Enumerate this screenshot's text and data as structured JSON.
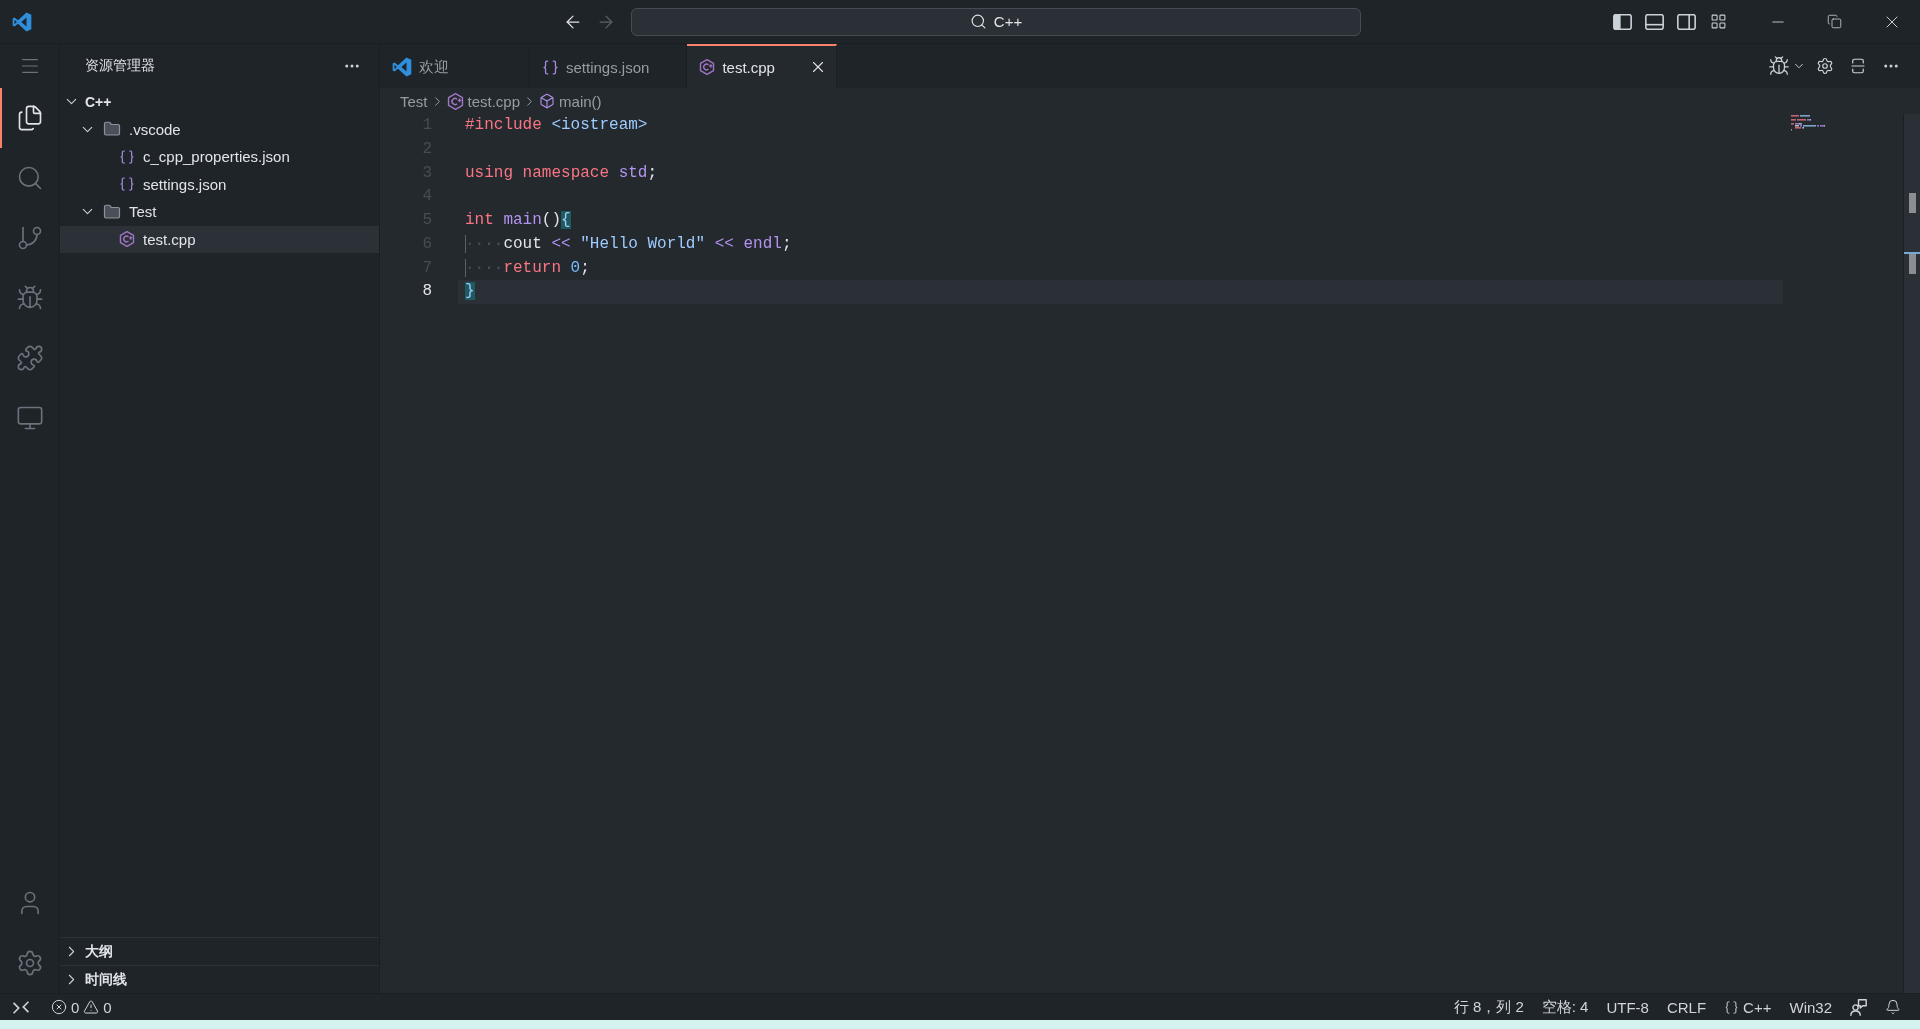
{
  "title_bar": {
    "navigation": {
      "back": {
        "disabled": false
      },
      "forward": {
        "disabled": true
      }
    },
    "command_center": {
      "label": "C++"
    },
    "layout_toggles": [
      {
        "kind": "primary_sidebar",
        "on": true
      },
      {
        "kind": "panel",
        "on": false
      },
      {
        "kind": "secondary_sidebar",
        "on": false
      }
    ]
  },
  "activity_bar": {
    "items": [
      {
        "kind": "explorer",
        "selected": true
      },
      {
        "kind": "search",
        "selected": false
      },
      {
        "kind": "source_control",
        "selected": false
      },
      {
        "kind": "run_debug",
        "selected": false
      },
      {
        "kind": "extensions",
        "selected": false
      },
      {
        "kind": "remote_explorer",
        "selected": false
      }
    ],
    "bottom": [
      {
        "kind": "accounts"
      },
      {
        "kind": "manage"
      }
    ]
  },
  "sidebar": {
    "title": "资源管理器",
    "tree": [
      {
        "label": "C++",
        "kind": "root",
        "expanded": true,
        "selected": false,
        "children": [
          {
            "label": ".vscode",
            "kind": "folder",
            "expanded": true,
            "selected": false,
            "children": [
              {
                "label": "c_cpp_properties.json",
                "kind": "json",
                "selected": false
              },
              {
                "label": "settings.json",
                "kind": "json",
                "selected": false
              }
            ]
          },
          {
            "label": "Test",
            "kind": "folder",
            "expanded": true,
            "selected": false,
            "children": [
              {
                "label": "test.cpp",
                "kind": "cpp",
                "selected": true
              }
            ]
          }
        ]
      }
    ],
    "sections": [
      {
        "label": "大纲",
        "expanded": false
      },
      {
        "label": "时间线",
        "expanded": false
      }
    ]
  },
  "tabs": [
    {
      "label": "欢迎",
      "kind": "welcome",
      "selected": false
    },
    {
      "label": "settings.json",
      "kind": "json",
      "selected": false
    },
    {
      "label": "test.cpp",
      "kind": "cpp",
      "selected": true
    }
  ],
  "breadcrumbs": [
    {
      "label": "Test",
      "kind": "folder"
    },
    {
      "label": "test.cpp",
      "kind": "cpp"
    },
    {
      "label": "main()",
      "kind": "symbol"
    }
  ],
  "editor": {
    "lines": [
      {
        "number": "1",
        "current": false,
        "tokens": [
          {
            "text": "#include",
            "kind": "keyword"
          },
          {
            "text": " <iostream>",
            "kind": "string"
          }
        ]
      },
      {
        "number": "2",
        "current": false
      },
      {
        "number": "3",
        "current": false,
        "tokens": [
          {
            "text": "using",
            "kind": "keyword"
          },
          {
            "text": " namespace",
            "kind": "keyword"
          },
          {
            "text": " std",
            "kind": "entity"
          },
          {
            "text": ";",
            "kind": "plain"
          }
        ]
      },
      {
        "number": "4",
        "current": false
      },
      {
        "number": "5",
        "current": false,
        "tokens": [
          {
            "text": "int",
            "kind": "keyword"
          },
          {
            "text": " main",
            "kind": "entity"
          },
          {
            "text": "()",
            "kind": "plain"
          },
          {
            "text": "{",
            "kind": "bracket"
          }
        ]
      },
      {
        "number": "6",
        "current": false,
        "tokens": [
          {
            "text": "····",
            "kind": "whitespace"
          },
          {
            "text": "cout",
            "kind": "plain"
          },
          {
            "text": " <<",
            "kind": "operator"
          },
          {
            "text": " \"Hello World\"",
            "kind": "string"
          },
          {
            "text": " <<",
            "kind": "operator"
          },
          {
            "text": " endl",
            "kind": "entity"
          },
          {
            "text": ";",
            "kind": "plain"
          }
        ]
      },
      {
        "number": "7",
        "current": false,
        "tokens": [
          {
            "text": "····",
            "kind": "whitespace"
          },
          {
            "text": "return",
            "kind": "keyword"
          },
          {
            "text": " 0",
            "kind": "constant"
          },
          {
            "text": ";",
            "kind": "plain"
          }
        ]
      },
      {
        "number": "8",
        "current": true,
        "tokens": [
          {
            "text": "}",
            "kind": "bracket"
          }
        ]
      }
    ]
  },
  "status_bar": {
    "left": [
      {
        "kind": "remote"
      },
      {
        "kind": "problems",
        "errors": "0",
        "warnings": "0"
      }
    ],
    "right": [
      {
        "kind": "position",
        "label": "行 8，列 2"
      },
      {
        "kind": "indentation",
        "label": "空格: 4"
      },
      {
        "kind": "encoding",
        "label": "UTF-8"
      },
      {
        "kind": "eol",
        "label": "CRLF"
      },
      {
        "kind": "language",
        "label": "C++"
      },
      {
        "kind": "platform",
        "label": "Win32"
      },
      {
        "kind": "feedback"
      },
      {
        "kind": "notifications"
      }
    ]
  }
}
